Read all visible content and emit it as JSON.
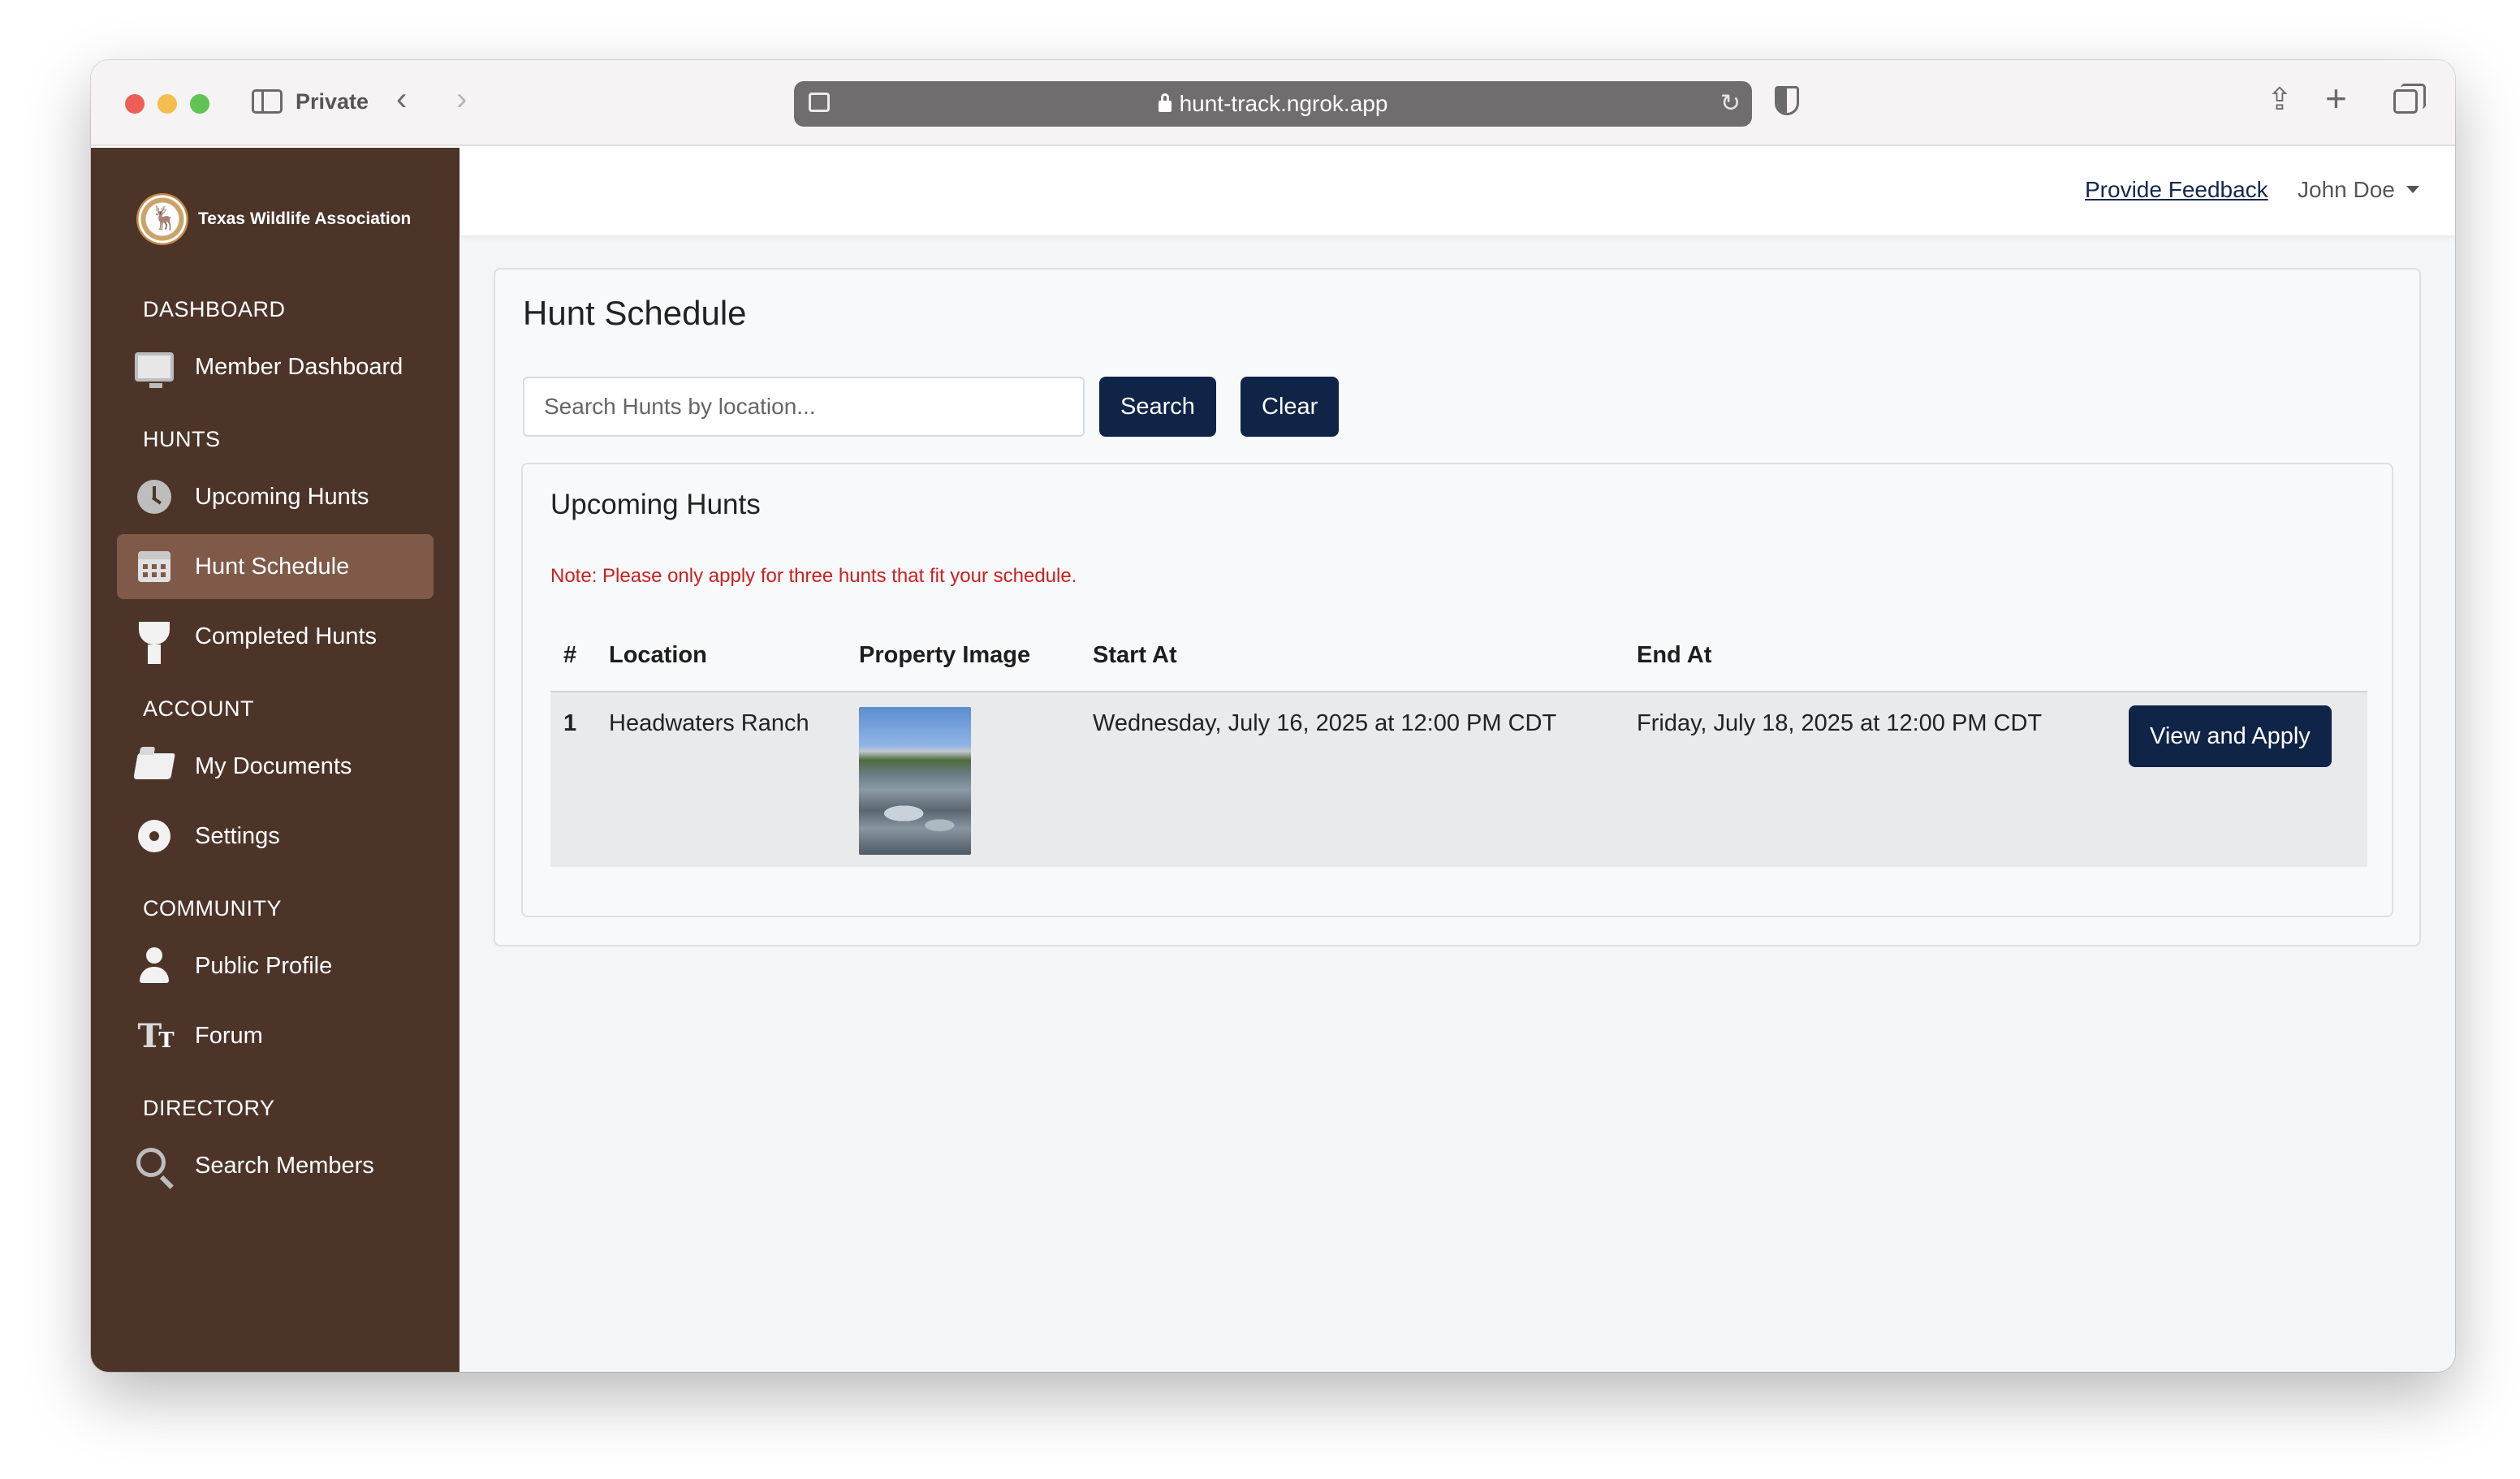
{
  "browser": {
    "private_label": "Private",
    "url": "hunt-track.ngrok.app"
  },
  "sidebar": {
    "brand": "Texas Wildlife Association",
    "sections": [
      {
        "header": "DASHBOARD",
        "items": [
          {
            "label": "Member Dashboard",
            "icon": "monitor-icon"
          }
        ]
      },
      {
        "header": "HUNTS",
        "items": [
          {
            "label": "Upcoming Hunts",
            "icon": "clock-icon"
          },
          {
            "label": "Hunt Schedule",
            "icon": "calendar-icon",
            "active": true
          },
          {
            "label": "Completed Hunts",
            "icon": "trophy-icon"
          }
        ]
      },
      {
        "header": "ACCOUNT",
        "items": [
          {
            "label": "My Documents",
            "icon": "folder-icon"
          },
          {
            "label": "Settings",
            "icon": "gear-icon"
          }
        ]
      },
      {
        "header": "COMMUNITY",
        "items": [
          {
            "label": "Public Profile",
            "icon": "person-icon"
          },
          {
            "label": "Forum",
            "icon": "text-size-icon"
          }
        ]
      },
      {
        "header": "DIRECTORY",
        "items": [
          {
            "label": "Search Members",
            "icon": "search-icon"
          }
        ]
      }
    ]
  },
  "topbar": {
    "feedback_link": "Provide Feedback",
    "user_name": "John Doe"
  },
  "main": {
    "title": "Hunt Schedule",
    "search": {
      "placeholder": "Search Hunts by location...",
      "value": "",
      "search_label": "Search",
      "clear_label": "Clear"
    },
    "upcoming": {
      "title": "Upcoming Hunts",
      "note": "Note: Please only apply for three hunts that fit your schedule.",
      "columns": [
        "#",
        "Location",
        "Property Image",
        "Start At",
        "End At",
        ""
      ],
      "rows": [
        {
          "num": "1",
          "location": "Headwaters Ranch",
          "start_at": "Wednesday, July 16, 2025 at 12:00 PM CDT",
          "end_at": "Friday, July 18, 2025 at 12:00 PM CDT",
          "action_label": "View and Apply"
        }
      ]
    }
  },
  "colors": {
    "sidebar_bg": "#4d3429",
    "sidebar_active": "#7f5a48",
    "primary_button": "#0f2447",
    "note_red": "#cc1f1f"
  }
}
